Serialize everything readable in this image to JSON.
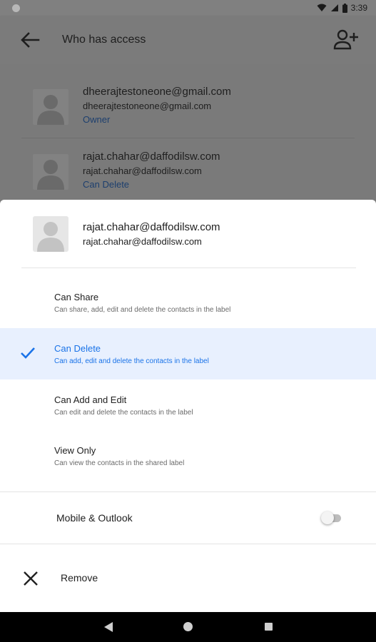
{
  "status_bar": {
    "time": "3:39"
  },
  "app_bar": {
    "title": "Who has access"
  },
  "access_list": [
    {
      "email_main": "dheerajtestoneone@gmail.com",
      "email_sub": "dheerajtestoneone@gmail.com",
      "role": "Owner"
    },
    {
      "email_main": "rajat.chahar@daffodilsw.com",
      "email_sub": "rajat.chahar@daffodilsw.com",
      "role": "Can Delete"
    }
  ],
  "sheet": {
    "email_main": "rajat.chahar@daffodilsw.com",
    "email_sub": "rajat.chahar@daffodilsw.com",
    "selected_permission": "Can Delete",
    "permissions": [
      {
        "title": "Can Share",
        "description": "Can share, add, edit and delete the contacts in the label"
      },
      {
        "title": "Can Delete",
        "description": "Can add, edit and delete the contacts in the label"
      },
      {
        "title": "Can Add and Edit",
        "description": "Can edit and delete the contacts in the label"
      },
      {
        "title": "View Only",
        "description": "Can view the contacts in the shared label"
      }
    ],
    "toggle": {
      "label": "Mobile & Outlook",
      "state": "off"
    },
    "remove_label": "Remove"
  },
  "colors": {
    "accent": "#1a73e8",
    "selected_bg": "#e8f0fe",
    "scrim": "#7a7a7a"
  },
  "icons": {
    "back": "arrow-left-icon",
    "add_person": "person-add-icon",
    "check": "check-icon",
    "remove": "close-icon"
  }
}
